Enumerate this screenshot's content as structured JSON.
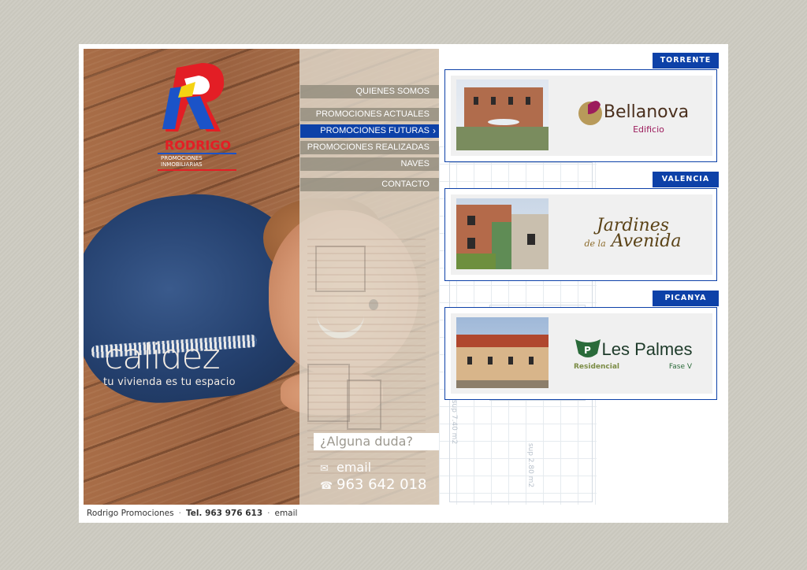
{
  "logo": {
    "name": "RODRIGO",
    "subtitle": "PROMOCIONES INMOBILIARIAS"
  },
  "hero": {
    "headline": "calidez",
    "tagline": "tu vivienda es tu espacio"
  },
  "menu": {
    "items": [
      {
        "label": "QUIENES SOMOS"
      },
      {
        "label": "PROMOCIONES ACTUALES"
      },
      {
        "label": "PROMOCIONES FUTURAS"
      },
      {
        "label": "PROMOCIONES REALIZADAS"
      },
      {
        "label": "NAVES"
      },
      {
        "label": "CONTACTO"
      }
    ],
    "active_index": 2
  },
  "contact": {
    "question": "¿Alguna duda?",
    "email_label": "email",
    "phone": "963 642 018"
  },
  "cards": [
    {
      "location": "TORRENTE",
      "brand": "Bellanova",
      "brand_sub": "Edificio"
    },
    {
      "location": "VALENCIA",
      "brand_line1": "Jardines",
      "brand_line2": "de la",
      "brand_line3": "Avenida"
    },
    {
      "location": "PICANYA",
      "brand_res": "Residencial",
      "brand": "Les Palmes",
      "brand_sub": "Fase V"
    }
  ],
  "blueprint": {
    "label1": "sup 2.80 m2",
    "label2": "sup 7.40 m2"
  },
  "footer": {
    "company": "Rodrigo Promociones",
    "phone": "Tel. 963 976 613",
    "email": "email"
  },
  "colors": {
    "brand_blue": "#0d41a8",
    "logo_red": "#e31e25"
  }
}
